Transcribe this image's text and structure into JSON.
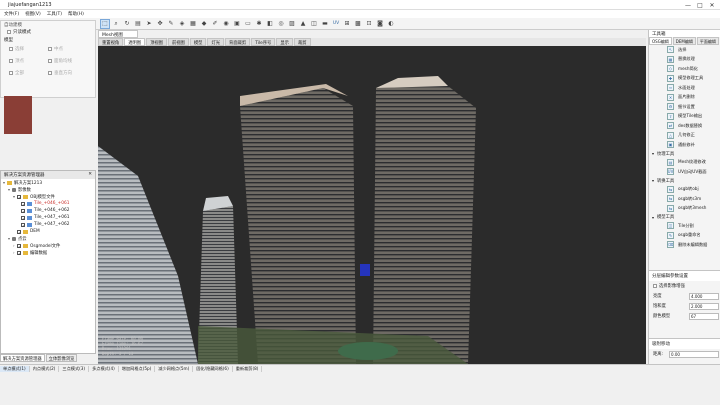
{
  "app": {
    "title": "jiajuefangan1213"
  },
  "window_controls": {
    "minimize": "—",
    "maximize": "□",
    "close": "✕"
  },
  "menu": {
    "items": [
      "文件(F)",
      "视图(V)",
      "工具(T)",
      "帮助(H)"
    ]
  },
  "toolbar": {
    "icons": [
      "select-icon",
      "zoom-icon",
      "rotate-icon",
      "layer-icon",
      "cursor-icon",
      "move-icon",
      "edit-icon",
      "paint-icon",
      "grid-icon",
      "tag-icon",
      "draw-icon",
      "pin-icon",
      "box-icon",
      "rect-icon",
      "brush-icon",
      "cube-icon",
      "eye-icon",
      "image-icon",
      "terrain-icon",
      "mesh-icon",
      "flatten-icon",
      "uv-icon",
      "ruler-icon",
      "tile-icon",
      "lock-icon",
      "camera-icon",
      "render-icon"
    ],
    "uv_label": "UV"
  },
  "left_top_panel": {
    "header": "自动建模",
    "checkbox_label": "只读模式",
    "section_label": "模型",
    "options": [
      "选择",
      "中点",
      "顶点",
      "面角均线",
      "全部",
      "垂直方向"
    ]
  },
  "tree_panel": {
    "title": "解决方案资源管理器",
    "root": "解决方案1213",
    "items": [
      {
        "label": "影像数",
        "level": 1,
        "icon": "db",
        "expanded": true
      },
      {
        "label": "OBJ模型文件",
        "level": 2,
        "icon": "folder",
        "expanded": true
      },
      {
        "label": "Tile_+046_+061",
        "level": 3,
        "icon": "tile",
        "checked": true,
        "highlight": true
      },
      {
        "label": "Tile_+046_+062",
        "level": 3,
        "icon": "tile",
        "checked": true,
        "highlight": false
      },
      {
        "label": "Tile_+047_+061",
        "level": 3,
        "icon": "tile",
        "checked": true,
        "highlight": false
      },
      {
        "label": "Tile_+047_+062",
        "level": 3,
        "icon": "tile",
        "checked": true,
        "highlight": false
      },
      {
        "label": "DEM",
        "level": 2,
        "icon": "folder",
        "checked": true
      },
      {
        "label": "点云",
        "level": 1,
        "icon": "db",
        "expanded": true
      },
      {
        "label": "Osgmodel文件",
        "level": 2,
        "icon": "folder",
        "checked": true
      },
      {
        "label": "编辑数据",
        "level": 2,
        "icon": "folder",
        "checked": true
      }
    ],
    "tabs": [
      "解决方案资源管理器",
      "立体影像浏览"
    ]
  },
  "viewport": {
    "doc_tab": "Mesh视图",
    "tabs": [
      "重置视角",
      "透明图",
      "顶视图",
      "前视图",
      "模型",
      "灯光",
      "背面裁剪",
      "Tile序号",
      "显示",
      "裁剪"
    ],
    "active_tab_index": 1,
    "overlay": [
      "Frame Rate: 60.00",
      "Frame Time: 16.67",
      "Draw: 131291",
      "Depth: 3 / 13"
    ]
  },
  "right_panel": {
    "title": "工具箱",
    "tabs": [
      "OSG编辑",
      "DEM编辑",
      "平面编辑"
    ],
    "tool_items": [
      {
        "label": "选择",
        "icon": "select-icon"
      },
      {
        "label": "替换纹理",
        "icon": "texture-icon"
      },
      {
        "label": "mesh简化",
        "icon": "simplify-icon"
      },
      {
        "label": "模型修理工具",
        "icon": "repair-icon"
      },
      {
        "label": "水面处理",
        "icon": "water-icon"
      },
      {
        "label": "面片删除",
        "icon": "delete-icon"
      },
      {
        "label": "细节设置",
        "icon": "detail-icon"
      },
      {
        "label": "模型Tile输出",
        "icon": "export-icon"
      },
      {
        "label": "des数据替换",
        "icon": "replace-icon"
      },
      {
        "label": "几何修正",
        "icon": "geometry-icon"
      },
      {
        "label": "通航修补",
        "icon": "patch-icon"
      }
    ],
    "groups": [
      {
        "label": "纹理工具",
        "items": [
          {
            "label": "Mesh纹理修改",
            "icon": "mesh-texture-icon"
          },
          {
            "label": "UV自动UV截面",
            "icon": "uv-icon"
          }
        ]
      },
      {
        "label": "转换工具",
        "items": [
          {
            "label": "osgb转obj",
            "icon": "convert-icon"
          },
          {
            "label": "osgb转s3m",
            "icon": "convert-icon"
          },
          {
            "label": "osgb转3mesh",
            "icon": "convert-icon"
          }
        ]
      },
      {
        "label": "模型工具",
        "items": [
          {
            "label": "Tile分割",
            "icon": "split-icon"
          },
          {
            "label": "osgb重命名",
            "icon": "rename-icon"
          },
          {
            "label": "删除未编辑数据",
            "icon": "clean-icon"
          }
        ]
      }
    ],
    "properties": {
      "title": "分层编辑参数设置",
      "checkbox_label": "选择影像增强",
      "rows": [
        {
          "label": "亮度",
          "value": "4.000"
        },
        {
          "label": "饱和度",
          "value": "2.000"
        },
        {
          "label": "颜色模型",
          "value": "67"
        }
      ]
    },
    "snap": {
      "title": "吸附移动",
      "label": "距离:",
      "value": "0.00"
    }
  },
  "statusbar": {
    "items": [
      "单点模式(1)",
      "内点模式(2)",
      "三点模式(3)",
      "多点模式(4)",
      "增加网格点(5p)",
      "减少网格点(5m)",
      "固化/隐藏网格(6)",
      "重新裁剪(8)"
    ],
    "active_index": 0
  },
  "colors": {
    "viewport_bg": "#2b2b2b",
    "selection": "#cfe3f7",
    "tile_highlight": "#c9302c"
  }
}
